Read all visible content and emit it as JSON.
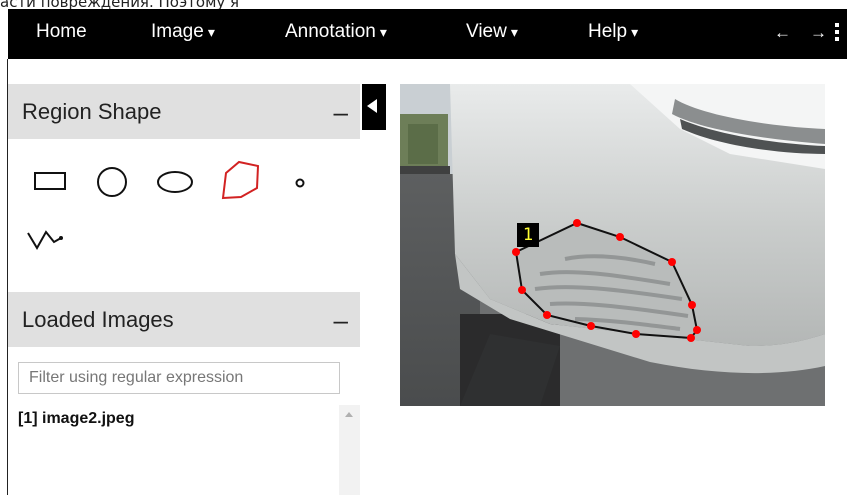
{
  "page_caption": "асти повреждения. Поэтому я",
  "menu": {
    "home": "Home",
    "image": "Image",
    "annotation": "Annotation",
    "view": "View",
    "help": "Help",
    "caret": "▾",
    "prev_arrow": "←",
    "next_arrow": "→"
  },
  "region_shape": {
    "title": "Region Shape",
    "collapse": "–",
    "tools": [
      "rectangle",
      "circle",
      "ellipse",
      "polygon",
      "point",
      "polyline"
    ],
    "selected": "polygon"
  },
  "loaded_images": {
    "title": "Loaded Images",
    "collapse": "–",
    "filter_placeholder": "Filter using regular expression",
    "items": [
      "[1] image2.jpeg"
    ]
  },
  "annotation": {
    "region_id": "1"
  },
  "colors": {
    "menu_bar": "#000000",
    "panel_header": "#e0e0e0",
    "selected_tool": "#d22222",
    "vertex": "#ff0000",
    "region_label_text": "#ffff33"
  }
}
